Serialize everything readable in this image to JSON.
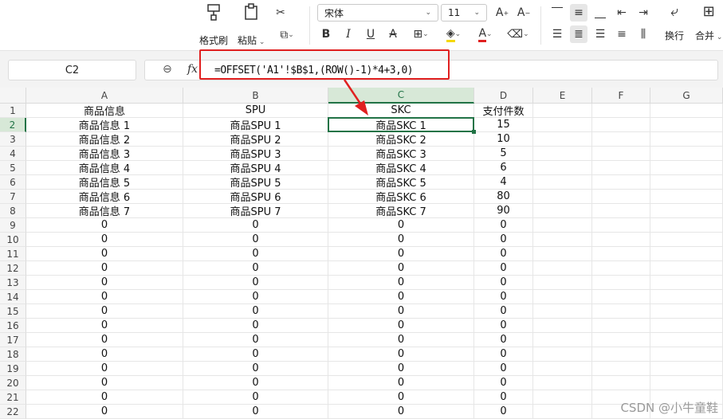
{
  "ribbon": {
    "format_painter_label": "格式刷",
    "paste_label": "粘贴",
    "font_name": "宋体",
    "font_size": "11",
    "wrap_label": "换行",
    "merge_label": "合并"
  },
  "formula_bar": {
    "name_box": "C2",
    "fx_symbol": "fx",
    "formula": "=OFFSET('A1'!$B$1,(ROW()-1)*4+3,0)"
  },
  "grid": {
    "columns": [
      "A",
      "B",
      "C",
      "D",
      "E",
      "F",
      "G"
    ],
    "selected_column": "C",
    "selected_row": "2",
    "rows": [
      {
        "num": "1",
        "cells": [
          "商品信息",
          "SPU",
          "SKC",
          "支付件数"
        ]
      },
      {
        "num": "2",
        "cells": [
          "商品信息 1",
          "商品SPU 1",
          "商品SKC 1",
          "15"
        ]
      },
      {
        "num": "3",
        "cells": [
          "商品信息 2",
          "商品SPU 2",
          "商品SKC 2",
          "10"
        ]
      },
      {
        "num": "4",
        "cells": [
          "商品信息 3",
          "商品SPU 3",
          "商品SKC 3",
          "5"
        ]
      },
      {
        "num": "5",
        "cells": [
          "商品信息 4",
          "商品SPU 4",
          "商品SKC 4",
          "6"
        ]
      },
      {
        "num": "6",
        "cells": [
          "商品信息 5",
          "商品SPU 5",
          "商品SKC 5",
          "4"
        ]
      },
      {
        "num": "7",
        "cells": [
          "商品信息 6",
          "商品SPU 6",
          "商品SKC 6",
          "80"
        ]
      },
      {
        "num": "8",
        "cells": [
          "商品信息 7",
          "商品SPU 7",
          "商品SKC 7",
          "90"
        ]
      },
      {
        "num": "9",
        "cells": [
          "0",
          "0",
          "0",
          "0"
        ]
      },
      {
        "num": "10",
        "cells": [
          "0",
          "0",
          "0",
          "0"
        ]
      },
      {
        "num": "11",
        "cells": [
          "0",
          "0",
          "0",
          "0"
        ]
      },
      {
        "num": "12",
        "cells": [
          "0",
          "0",
          "0",
          "0"
        ]
      },
      {
        "num": "13",
        "cells": [
          "0",
          "0",
          "0",
          "0"
        ]
      },
      {
        "num": "14",
        "cells": [
          "0",
          "0",
          "0",
          "0"
        ]
      },
      {
        "num": "15",
        "cells": [
          "0",
          "0",
          "0",
          "0"
        ]
      },
      {
        "num": "16",
        "cells": [
          "0",
          "0",
          "0",
          "0"
        ]
      },
      {
        "num": "17",
        "cells": [
          "0",
          "0",
          "0",
          "0"
        ]
      },
      {
        "num": "18",
        "cells": [
          "0",
          "0",
          "0",
          "0"
        ]
      },
      {
        "num": "19",
        "cells": [
          "0",
          "0",
          "0",
          "0"
        ]
      },
      {
        "num": "20",
        "cells": [
          "0",
          "0",
          "0",
          "0"
        ]
      },
      {
        "num": "21",
        "cells": [
          "0",
          "0",
          "0",
          "0"
        ]
      },
      {
        "num": "22",
        "cells": [
          "0",
          "0",
          "0",
          "0"
        ]
      }
    ]
  },
  "watermark": "CSDN @小牛童鞋",
  "colors": {
    "selection": "#217346",
    "annotation": "#e02020"
  }
}
